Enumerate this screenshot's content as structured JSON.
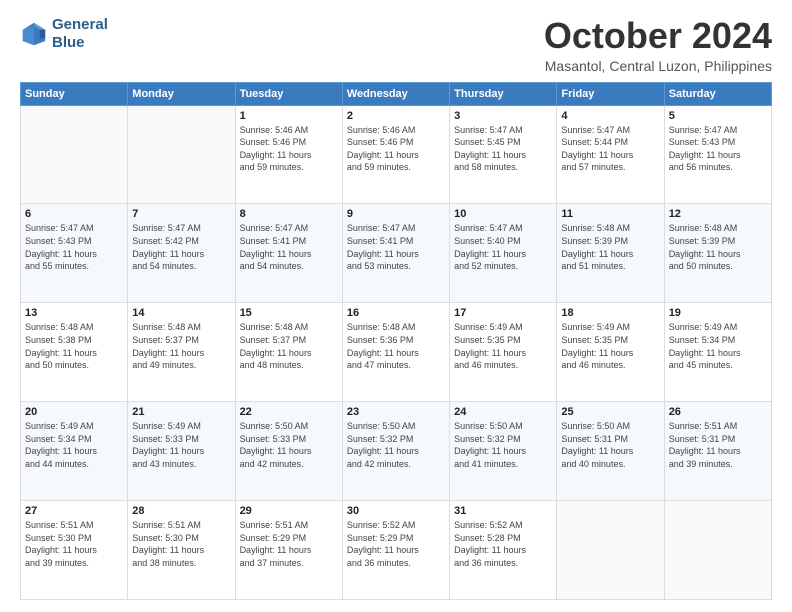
{
  "header": {
    "logo_line1": "General",
    "logo_line2": "Blue",
    "month": "October 2024",
    "location": "Masantol, Central Luzon, Philippines"
  },
  "weekdays": [
    "Sunday",
    "Monday",
    "Tuesday",
    "Wednesday",
    "Thursday",
    "Friday",
    "Saturday"
  ],
  "weeks": [
    [
      {
        "day": "",
        "text": ""
      },
      {
        "day": "",
        "text": ""
      },
      {
        "day": "1",
        "text": "Sunrise: 5:46 AM\nSunset: 5:46 PM\nDaylight: 11 hours\nand 59 minutes."
      },
      {
        "day": "2",
        "text": "Sunrise: 5:46 AM\nSunset: 5:46 PM\nDaylight: 11 hours\nand 59 minutes."
      },
      {
        "day": "3",
        "text": "Sunrise: 5:47 AM\nSunset: 5:45 PM\nDaylight: 11 hours\nand 58 minutes."
      },
      {
        "day": "4",
        "text": "Sunrise: 5:47 AM\nSunset: 5:44 PM\nDaylight: 11 hours\nand 57 minutes."
      },
      {
        "day": "5",
        "text": "Sunrise: 5:47 AM\nSunset: 5:43 PM\nDaylight: 11 hours\nand 56 minutes."
      }
    ],
    [
      {
        "day": "6",
        "text": "Sunrise: 5:47 AM\nSunset: 5:43 PM\nDaylight: 11 hours\nand 55 minutes."
      },
      {
        "day": "7",
        "text": "Sunrise: 5:47 AM\nSunset: 5:42 PM\nDaylight: 11 hours\nand 54 minutes."
      },
      {
        "day": "8",
        "text": "Sunrise: 5:47 AM\nSunset: 5:41 PM\nDaylight: 11 hours\nand 54 minutes."
      },
      {
        "day": "9",
        "text": "Sunrise: 5:47 AM\nSunset: 5:41 PM\nDaylight: 11 hours\nand 53 minutes."
      },
      {
        "day": "10",
        "text": "Sunrise: 5:47 AM\nSunset: 5:40 PM\nDaylight: 11 hours\nand 52 minutes."
      },
      {
        "day": "11",
        "text": "Sunrise: 5:48 AM\nSunset: 5:39 PM\nDaylight: 11 hours\nand 51 minutes."
      },
      {
        "day": "12",
        "text": "Sunrise: 5:48 AM\nSunset: 5:39 PM\nDaylight: 11 hours\nand 50 minutes."
      }
    ],
    [
      {
        "day": "13",
        "text": "Sunrise: 5:48 AM\nSunset: 5:38 PM\nDaylight: 11 hours\nand 50 minutes."
      },
      {
        "day": "14",
        "text": "Sunrise: 5:48 AM\nSunset: 5:37 PM\nDaylight: 11 hours\nand 49 minutes."
      },
      {
        "day": "15",
        "text": "Sunrise: 5:48 AM\nSunset: 5:37 PM\nDaylight: 11 hours\nand 48 minutes."
      },
      {
        "day": "16",
        "text": "Sunrise: 5:48 AM\nSunset: 5:36 PM\nDaylight: 11 hours\nand 47 minutes."
      },
      {
        "day": "17",
        "text": "Sunrise: 5:49 AM\nSunset: 5:35 PM\nDaylight: 11 hours\nand 46 minutes."
      },
      {
        "day": "18",
        "text": "Sunrise: 5:49 AM\nSunset: 5:35 PM\nDaylight: 11 hours\nand 46 minutes."
      },
      {
        "day": "19",
        "text": "Sunrise: 5:49 AM\nSunset: 5:34 PM\nDaylight: 11 hours\nand 45 minutes."
      }
    ],
    [
      {
        "day": "20",
        "text": "Sunrise: 5:49 AM\nSunset: 5:34 PM\nDaylight: 11 hours\nand 44 minutes."
      },
      {
        "day": "21",
        "text": "Sunrise: 5:49 AM\nSunset: 5:33 PM\nDaylight: 11 hours\nand 43 minutes."
      },
      {
        "day": "22",
        "text": "Sunrise: 5:50 AM\nSunset: 5:33 PM\nDaylight: 11 hours\nand 42 minutes."
      },
      {
        "day": "23",
        "text": "Sunrise: 5:50 AM\nSunset: 5:32 PM\nDaylight: 11 hours\nand 42 minutes."
      },
      {
        "day": "24",
        "text": "Sunrise: 5:50 AM\nSunset: 5:32 PM\nDaylight: 11 hours\nand 41 minutes."
      },
      {
        "day": "25",
        "text": "Sunrise: 5:50 AM\nSunset: 5:31 PM\nDaylight: 11 hours\nand 40 minutes."
      },
      {
        "day": "26",
        "text": "Sunrise: 5:51 AM\nSunset: 5:31 PM\nDaylight: 11 hours\nand 39 minutes."
      }
    ],
    [
      {
        "day": "27",
        "text": "Sunrise: 5:51 AM\nSunset: 5:30 PM\nDaylight: 11 hours\nand 39 minutes."
      },
      {
        "day": "28",
        "text": "Sunrise: 5:51 AM\nSunset: 5:30 PM\nDaylight: 11 hours\nand 38 minutes."
      },
      {
        "day": "29",
        "text": "Sunrise: 5:51 AM\nSunset: 5:29 PM\nDaylight: 11 hours\nand 37 minutes."
      },
      {
        "day": "30",
        "text": "Sunrise: 5:52 AM\nSunset: 5:29 PM\nDaylight: 11 hours\nand 36 minutes."
      },
      {
        "day": "31",
        "text": "Sunrise: 5:52 AM\nSunset: 5:28 PM\nDaylight: 11 hours\nand 36 minutes."
      },
      {
        "day": "",
        "text": ""
      },
      {
        "day": "",
        "text": ""
      }
    ]
  ]
}
